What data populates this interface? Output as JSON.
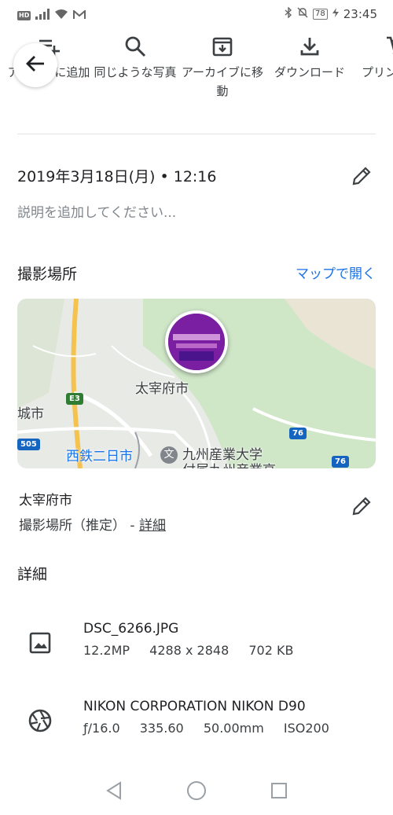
{
  "status_bar": {
    "hd": "HD",
    "battery": "78",
    "time": "23:45"
  },
  "actions": [
    {
      "label": "アルバムに追加",
      "icon": "playlist-add-icon"
    },
    {
      "label": "同じような写真",
      "icon": "search-icon"
    },
    {
      "label": "アーカイブに移動",
      "icon": "archive-icon"
    },
    {
      "label": "ダウンロード",
      "icon": "download-icon"
    },
    {
      "label": "プリント注文",
      "icon": "cart-icon"
    }
  ],
  "info": {
    "datetime": "2019年3月18日(月) • 12:16",
    "description_placeholder": "説明を追加してください..."
  },
  "location": {
    "title": "撮影場所",
    "open_map": "マップで開く",
    "map_labels": {
      "city": "太宰府市",
      "city_left": "城市",
      "station": "西鉄二日市",
      "station_icon": "文",
      "university_line1": "九州産業大学",
      "university_line2": "付属九州産業高",
      "route_e3": "E3",
      "route_76a": "76",
      "route_76b": "76",
      "route_505": "505"
    },
    "place_name": "太宰府市",
    "place_sub": "撮影場所（推定） - ",
    "place_link": "詳細"
  },
  "details": {
    "title": "詳細",
    "file": {
      "name": "DSC_6266.JPG",
      "megapixels": "12.2MP",
      "resolution": "4288 x 2848",
      "size": "702 KB"
    },
    "camera": {
      "model": "NIKON CORPORATION NIKON D90",
      "aperture": "ƒ/16.0",
      "shutter": "335.60",
      "focal": "50.00mm",
      "iso": "ISO200"
    }
  },
  "colors": {
    "accent": "#1a73e8",
    "text": "#202124",
    "muted": "#80868b"
  }
}
